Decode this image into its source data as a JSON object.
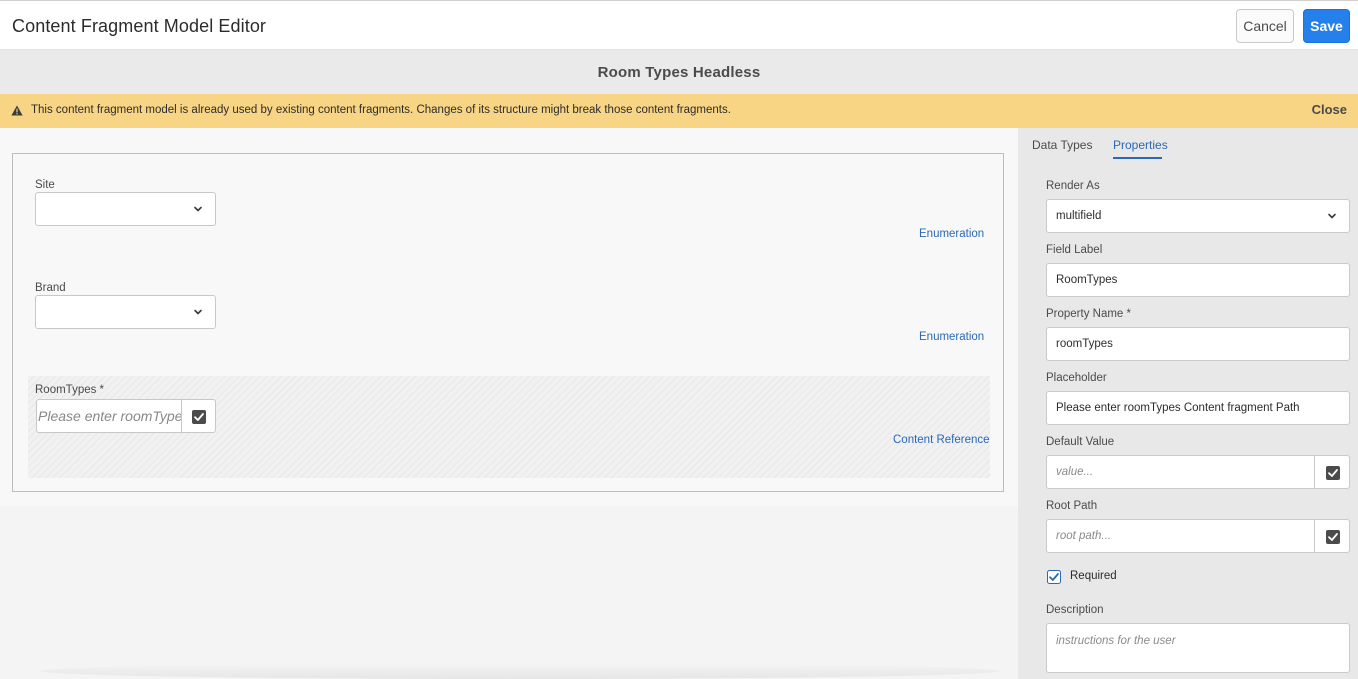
{
  "header": {
    "title": "Content Fragment Model Editor",
    "cancel_label": "Cancel",
    "save_label": "Save"
  },
  "model": {
    "title": "Room Types Headless"
  },
  "warning": {
    "text": "This content fragment model is already used by existing content fragments. Changes of its structure might break those content fragments.",
    "close_label": "Close"
  },
  "canvas": {
    "fields": [
      {
        "label": "Site",
        "type": "Enumeration",
        "value": ""
      },
      {
        "label": "Brand",
        "type": "Enumeration",
        "value": ""
      },
      {
        "label": "RoomTypes *",
        "type": "Content Reference",
        "placeholder": "Please enter roomTypes C"
      }
    ]
  },
  "sidebar": {
    "tabs": [
      "Data Types",
      "Properties"
    ],
    "active_tab": "Properties",
    "properties": {
      "render_as_label": "Render As",
      "render_as_value": "multifield",
      "field_label_label": "Field Label",
      "field_label_value": "RoomTypes",
      "property_name_label": "Property Name *",
      "property_name_value": "roomTypes",
      "placeholder_label": "Placeholder",
      "placeholder_value": "Please enter roomTypes Content fragment Path",
      "default_value_label": "Default Value",
      "default_value_placeholder": "value...",
      "root_path_label": "Root Path",
      "root_path_placeholder": "root path...",
      "required_label": "Required",
      "required_checked": true,
      "description_label": "Description",
      "description_placeholder": "instructions for the user"
    }
  },
  "colors": {
    "accent": "#2680eb",
    "link": "#2b68b5",
    "warning_bg": "#f8d584"
  },
  "icons": [
    "warning-icon",
    "chevron-down-icon",
    "checkbox-icon",
    "checkmark-icon"
  ]
}
